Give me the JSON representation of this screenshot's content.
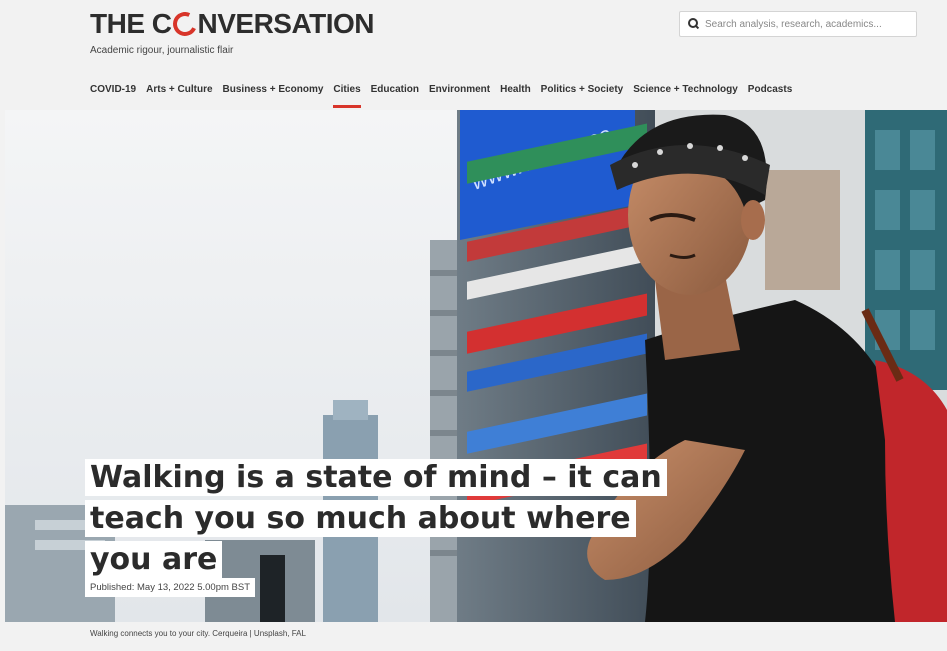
{
  "header": {
    "logo_part1": "THE C",
    "logo_part2": "NVERSATION",
    "tagline": "Academic rigour, journalistic flair",
    "search_placeholder": "Search analysis, research, academics..."
  },
  "nav": {
    "items": [
      {
        "label": "COVID-19"
      },
      {
        "label": "Arts + Culture"
      },
      {
        "label": "Business + Economy"
      },
      {
        "label": "Cities",
        "active": true
      },
      {
        "label": "Education"
      },
      {
        "label": "Environment"
      },
      {
        "label": "Health"
      },
      {
        "label": "Politics + Society"
      },
      {
        "label": "Science + Technology"
      },
      {
        "label": "Podcasts"
      }
    ]
  },
  "article": {
    "headline_lines": [
      "Walking is a state of mind – it can",
      "teach you so much about where",
      "you are"
    ],
    "published": "Published: May 13, 2022 5.00pm BST",
    "caption": "Walking connects you to your city. Cerqueira | Unsplash, FAL"
  },
  "colors": {
    "brand_red": "#d8352a",
    "text_dark": "#2d2d2d",
    "page_bg": "#f2f2f2"
  }
}
